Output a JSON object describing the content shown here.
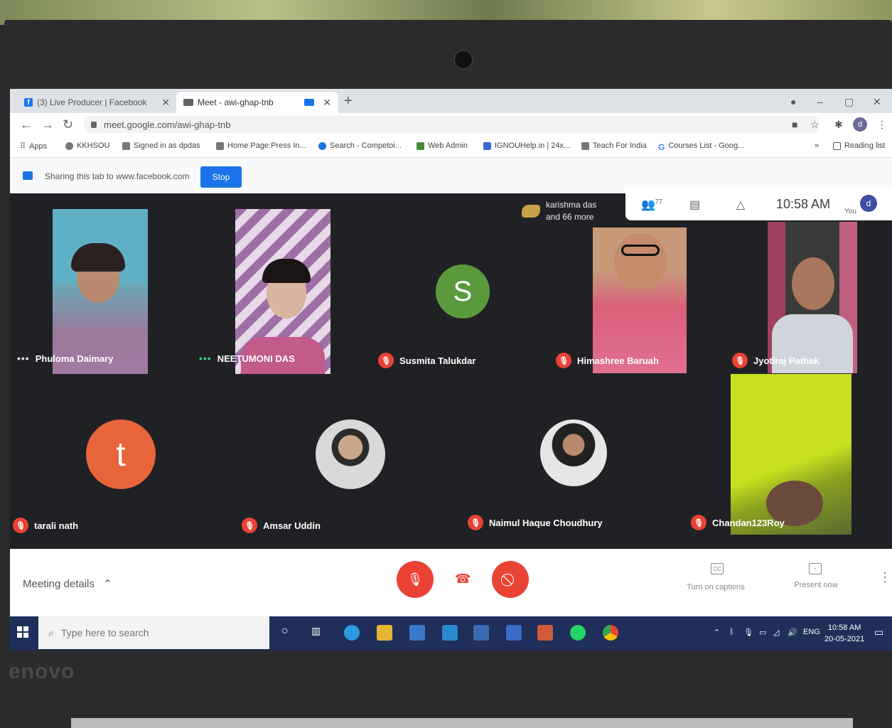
{
  "browser": {
    "tabs": [
      {
        "label": "(3) Live Producer | Facebook",
        "active": false
      },
      {
        "label": "Meet - awi-ghap-tnb",
        "active": true
      }
    ],
    "address": "meet.google.com/awi-ghap-tnb",
    "bookmarks": [
      "Apps",
      "KKHSOU",
      "Signed in as dpdas",
      "Home Page:Press In...",
      "Search - Competoi...",
      "Web Admin",
      "IGNOUHelp.in | 24x...",
      "Teach For India",
      "Courses List - Goog..."
    ],
    "more_bookmarks": "»",
    "reading_list": "Reading list",
    "profile_initial": "d"
  },
  "share_bar": {
    "text": "Sharing this tab to www.facebook.com",
    "stop_label": "Stop"
  },
  "meet": {
    "join_notice": {
      "line1": "karishma das",
      "line2": "and 66 more"
    },
    "people_count": "77",
    "time": "10:58 AM",
    "you_label": "You",
    "you_initial": "d",
    "participants": [
      {
        "name": "Phuloma Daimary",
        "muted": false
      },
      {
        "name": "NEETUMONI DAS",
        "muted": false
      },
      {
        "name": "Susmita Talukdar",
        "muted": true,
        "initial": "S"
      },
      {
        "name": "Himashree Baruah",
        "muted": true
      },
      {
        "name": "Jyotiraj Pathak",
        "muted": true
      },
      {
        "name": "tarali nath",
        "muted": true,
        "initial": "t"
      },
      {
        "name": "Amsar Uddin",
        "muted": true
      },
      {
        "name": "Naimul Haque Choudhury",
        "muted": true
      },
      {
        "name": "Chandan123Roy",
        "muted": true
      }
    ],
    "colors": {
      "red": "#ea4335",
      "green": "#5b9a3c",
      "orange": "#e8643a",
      "blue": "#1a73e8"
    }
  },
  "controls": {
    "meeting_details": "Meeting details",
    "captions": "Turn on captions",
    "present": "Present now",
    "captions_icon": "CC"
  },
  "taskbar": {
    "search_placeholder": "Type here to search",
    "lang": "ENG",
    "time": "10:58 AM",
    "date": "20-05-2021"
  },
  "laptop_brand": "enovo"
}
